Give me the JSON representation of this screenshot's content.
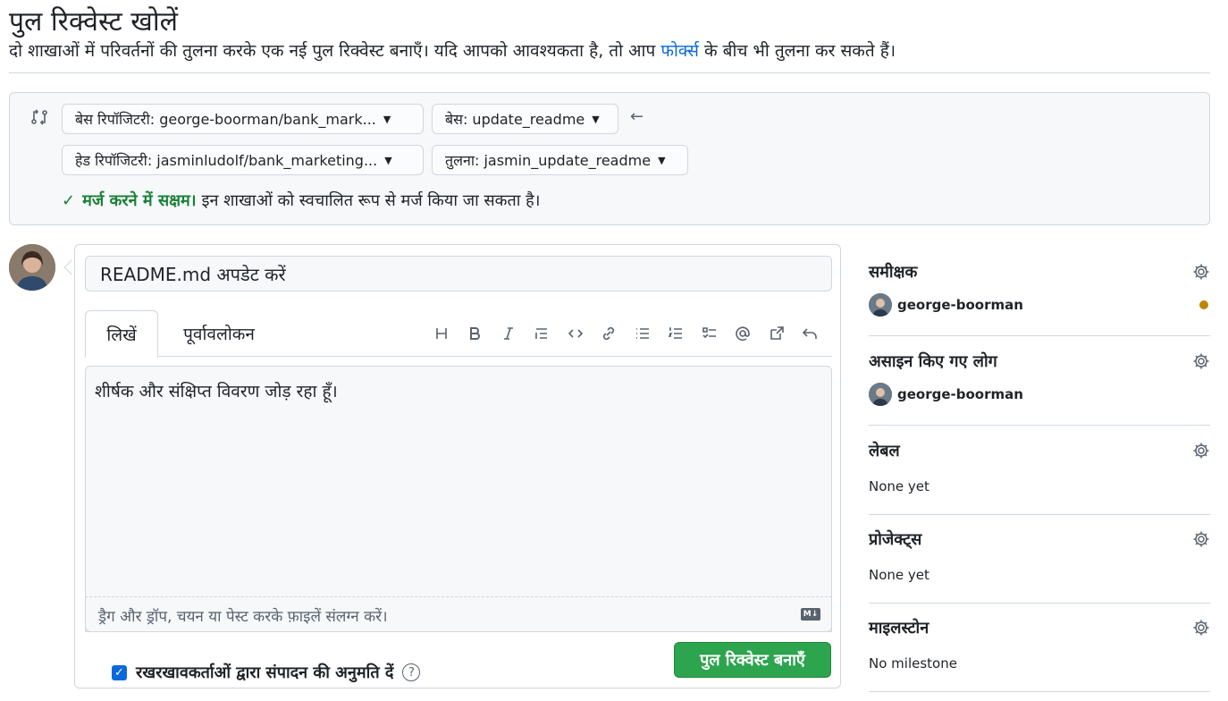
{
  "header": {
    "title": "पुल रिक्वेस्ट खोलें",
    "subtitle_before": "दो शाखाओं में परिवर्तनों की तुलना करके एक नई पुल रिक्वेस्ट बनाएँ। यदि आपको आवश्यकता है, तो आप ",
    "subtitle_link": "फोर्क्स",
    "subtitle_after": " के बीच भी तुलना कर सकते हैं।"
  },
  "compare": {
    "base_repo": "बेस रिपॉजिटरी: george-boorman/bank_mark...",
    "base_branch": "बेस: update_readme",
    "head_repo": "हेड रिपॉजिटरी: jasminludolf/bank_marketing...",
    "compare_branch": "तुलना: jasmin_update_readme",
    "merge_ok": "मर्ज करने में सक्षम।",
    "merge_desc": "इन शाखाओं को स्वचालित रूप से मर्ज किया जा सकता है।"
  },
  "editor": {
    "title_value": "README.md अपडेट करें",
    "tab_write": "लिखें",
    "tab_preview": "पूर्वावलोकन",
    "body_value": "शीर्षक और संक्षिप्त विवरण जोड़ रहा हूँ।",
    "attach_hint": "ड्रैग और ड्रॉप, चयन या पेस्ट करके फ़ाइलें संलग्न करें।",
    "markdown_badge": "M↓",
    "allow_edits_label": "रखरखावकर्ताओं द्वारा संपादन की अनुमति दें",
    "help_glyph": "?",
    "create_button": "पुल रिक्वेस्ट बनाएँ"
  },
  "sidebar": {
    "reviewers": {
      "heading": "समीक्षक",
      "user": "george-boorman"
    },
    "assignees": {
      "heading": "असाइन किए गए लोग",
      "user": "george-boorman"
    },
    "labels": {
      "heading": "लेबल",
      "value": "None yet"
    },
    "projects": {
      "heading": "प्रोजेक्ट्स",
      "value": "None yet"
    },
    "milestone": {
      "heading": "माइलस्टोन",
      "value": "No milestone"
    }
  },
  "colors": {
    "accent": "#0969da",
    "success": "#1a7f37",
    "button_green": "#2da44e",
    "pending_dot": "#bf8700"
  },
  "icons": [
    "compare-icon",
    "caret-down-icon",
    "arrow-left-icon",
    "check-icon",
    "heading-icon",
    "bold-icon",
    "italic-icon",
    "quote-icon",
    "code-icon",
    "link-icon",
    "unordered-list-icon",
    "ordered-list-icon",
    "task-list-icon",
    "mention-icon",
    "cross-reference-icon",
    "undo-icon",
    "markdown-icon",
    "help-icon",
    "gear-icon"
  ]
}
